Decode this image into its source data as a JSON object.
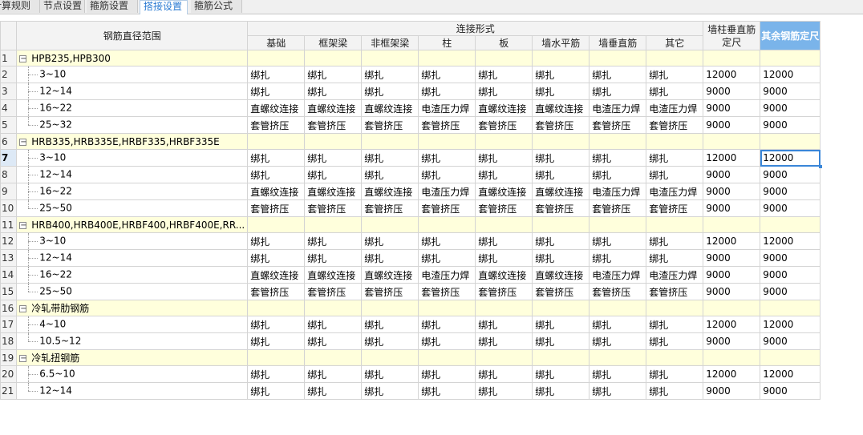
{
  "tabs": [
    {
      "label": "计算规则",
      "active": false
    },
    {
      "label": "节点设置",
      "active": false
    },
    {
      "label": "箍筋设置",
      "active": false
    },
    {
      "label": "搭接设置",
      "active": true
    },
    {
      "label": "箍筋公式",
      "active": false
    }
  ],
  "headers": {
    "range": "钢筋直径范围",
    "group": "连接形式",
    "cols": [
      "基础",
      "框架梁",
      "非框架梁",
      "柱",
      "板",
      "墙水平筋",
      "墙垂直筋",
      "其它"
    ],
    "wall_length_line1": "墙柱垂直筋",
    "wall_length_line2": "定尺",
    "other_length": "其余钢筋定尺"
  },
  "groups": [
    {
      "row": "1",
      "name": "HPB235,HPB300",
      "items": [
        {
          "row": "2",
          "range": "3~10",
          "conn": [
            "绑扎",
            "绑扎",
            "绑扎",
            "绑扎",
            "绑扎",
            "绑扎",
            "绑扎",
            "绑扎"
          ],
          "wall": "12000",
          "other": "12000"
        },
        {
          "row": "3",
          "range": "12~14",
          "conn": [
            "绑扎",
            "绑扎",
            "绑扎",
            "绑扎",
            "绑扎",
            "绑扎",
            "绑扎",
            "绑扎"
          ],
          "wall": "9000",
          "other": "9000"
        },
        {
          "row": "4",
          "range": "16~22",
          "conn": [
            "直螺纹连接",
            "直螺纹连接",
            "直螺纹连接",
            "电渣压力焊",
            "直螺纹连接",
            "直螺纹连接",
            "电渣压力焊",
            "电渣压力焊"
          ],
          "wall": "9000",
          "other": "9000"
        },
        {
          "row": "5",
          "range": "25~32",
          "conn": [
            "套管挤压",
            "套管挤压",
            "套管挤压",
            "套管挤压",
            "套管挤压",
            "套管挤压",
            "套管挤压",
            "套管挤压"
          ],
          "wall": "9000",
          "other": "9000"
        }
      ]
    },
    {
      "row": "6",
      "name": "HRB335,HRB335E,HRBF335,HRBF335E",
      "items": [
        {
          "row": "7",
          "range": "3~10",
          "conn": [
            "绑扎",
            "绑扎",
            "绑扎",
            "绑扎",
            "绑扎",
            "绑扎",
            "绑扎",
            "绑扎"
          ],
          "wall": "12000",
          "other": "12000",
          "selected": true
        },
        {
          "row": "8",
          "range": "12~14",
          "conn": [
            "绑扎",
            "绑扎",
            "绑扎",
            "绑扎",
            "绑扎",
            "绑扎",
            "绑扎",
            "绑扎"
          ],
          "wall": "9000",
          "other": "9000"
        },
        {
          "row": "9",
          "range": "16~22",
          "conn": [
            "直螺纹连接",
            "直螺纹连接",
            "直螺纹连接",
            "电渣压力焊",
            "直螺纹连接",
            "直螺纹连接",
            "电渣压力焊",
            "电渣压力焊"
          ],
          "wall": "9000",
          "other": "9000"
        },
        {
          "row": "10",
          "range": "25~50",
          "conn": [
            "套管挤压",
            "套管挤压",
            "套管挤压",
            "套管挤压",
            "套管挤压",
            "套管挤压",
            "套管挤压",
            "套管挤压"
          ],
          "wall": "9000",
          "other": "9000"
        }
      ]
    },
    {
      "row": "11",
      "name": "HRB400,HRB400E,HRBF400,HRBF400E,RR...",
      "items": [
        {
          "row": "12",
          "range": "3~10",
          "conn": [
            "绑扎",
            "绑扎",
            "绑扎",
            "绑扎",
            "绑扎",
            "绑扎",
            "绑扎",
            "绑扎"
          ],
          "wall": "12000",
          "other": "12000"
        },
        {
          "row": "13",
          "range": "12~14",
          "conn": [
            "绑扎",
            "绑扎",
            "绑扎",
            "绑扎",
            "绑扎",
            "绑扎",
            "绑扎",
            "绑扎"
          ],
          "wall": "9000",
          "other": "9000"
        },
        {
          "row": "14",
          "range": "16~22",
          "conn": [
            "直螺纹连接",
            "直螺纹连接",
            "直螺纹连接",
            "电渣压力焊",
            "直螺纹连接",
            "直螺纹连接",
            "电渣压力焊",
            "电渣压力焊"
          ],
          "wall": "9000",
          "other": "9000"
        },
        {
          "row": "15",
          "range": "25~50",
          "conn": [
            "套管挤压",
            "套管挤压",
            "套管挤压",
            "套管挤压",
            "套管挤压",
            "套管挤压",
            "套管挤压",
            "套管挤压"
          ],
          "wall": "9000",
          "other": "9000"
        }
      ]
    },
    {
      "row": "16",
      "name": "冷轧带肋钢筋",
      "items": [
        {
          "row": "17",
          "range": "4~10",
          "conn": [
            "绑扎",
            "绑扎",
            "绑扎",
            "绑扎",
            "绑扎",
            "绑扎",
            "绑扎",
            "绑扎"
          ],
          "wall": "12000",
          "other": "12000"
        },
        {
          "row": "18",
          "range": "10.5~12",
          "conn": [
            "绑扎",
            "绑扎",
            "绑扎",
            "绑扎",
            "绑扎",
            "绑扎",
            "绑扎",
            "绑扎"
          ],
          "wall": "9000",
          "other": "9000"
        }
      ]
    },
    {
      "row": "19",
      "name": "冷轧扭钢筋",
      "items": [
        {
          "row": "20",
          "range": "6.5~10",
          "conn": [
            "绑扎",
            "绑扎",
            "绑扎",
            "绑扎",
            "绑扎",
            "绑扎",
            "绑扎",
            "绑扎"
          ],
          "wall": "12000",
          "other": "12000"
        },
        {
          "row": "21",
          "range": "12~14",
          "conn": [
            "绑扎",
            "绑扎",
            "绑扎",
            "绑扎",
            "绑扎",
            "绑扎",
            "绑扎",
            "绑扎"
          ],
          "wall": "9000",
          "other": "9000"
        }
      ]
    }
  ]
}
